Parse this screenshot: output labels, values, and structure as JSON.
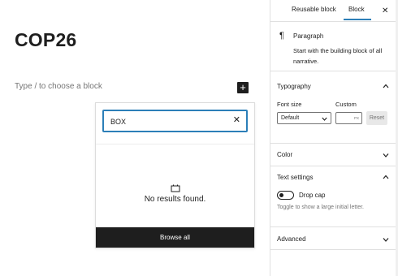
{
  "editor": {
    "post_title": "COP26",
    "block_placeholder": "Type / to choose a block",
    "add_block_symbol": "+"
  },
  "inserter": {
    "search_value": "BOX",
    "clear_symbol": "✕",
    "no_results_text": "No results found.",
    "browse_all_label": "Browse all"
  },
  "sidebar": {
    "tabs": [
      {
        "label": "Reusable block",
        "active": false
      },
      {
        "label": "Block",
        "active": true
      }
    ],
    "close_symbol": "✕",
    "block_card": {
      "icon": "¶",
      "name": "Paragraph",
      "description": "Start with the building block of all narrative."
    },
    "typography": {
      "title": "Typography",
      "font_size_label": "Font size",
      "custom_label": "Custom",
      "font_size_value": "Default",
      "custom_unit": "PX",
      "reset_label": "Reset"
    },
    "color": {
      "title": "Color"
    },
    "text_settings": {
      "title": "Text settings",
      "drop_cap_label": "Drop cap",
      "drop_cap_help": "Toggle to show a large initial letter."
    },
    "advanced": {
      "title": "Advanced"
    }
  },
  "colors": {
    "accent": "#2c7fb8",
    "dark": "#1e1e1e",
    "muted": "#757575"
  }
}
